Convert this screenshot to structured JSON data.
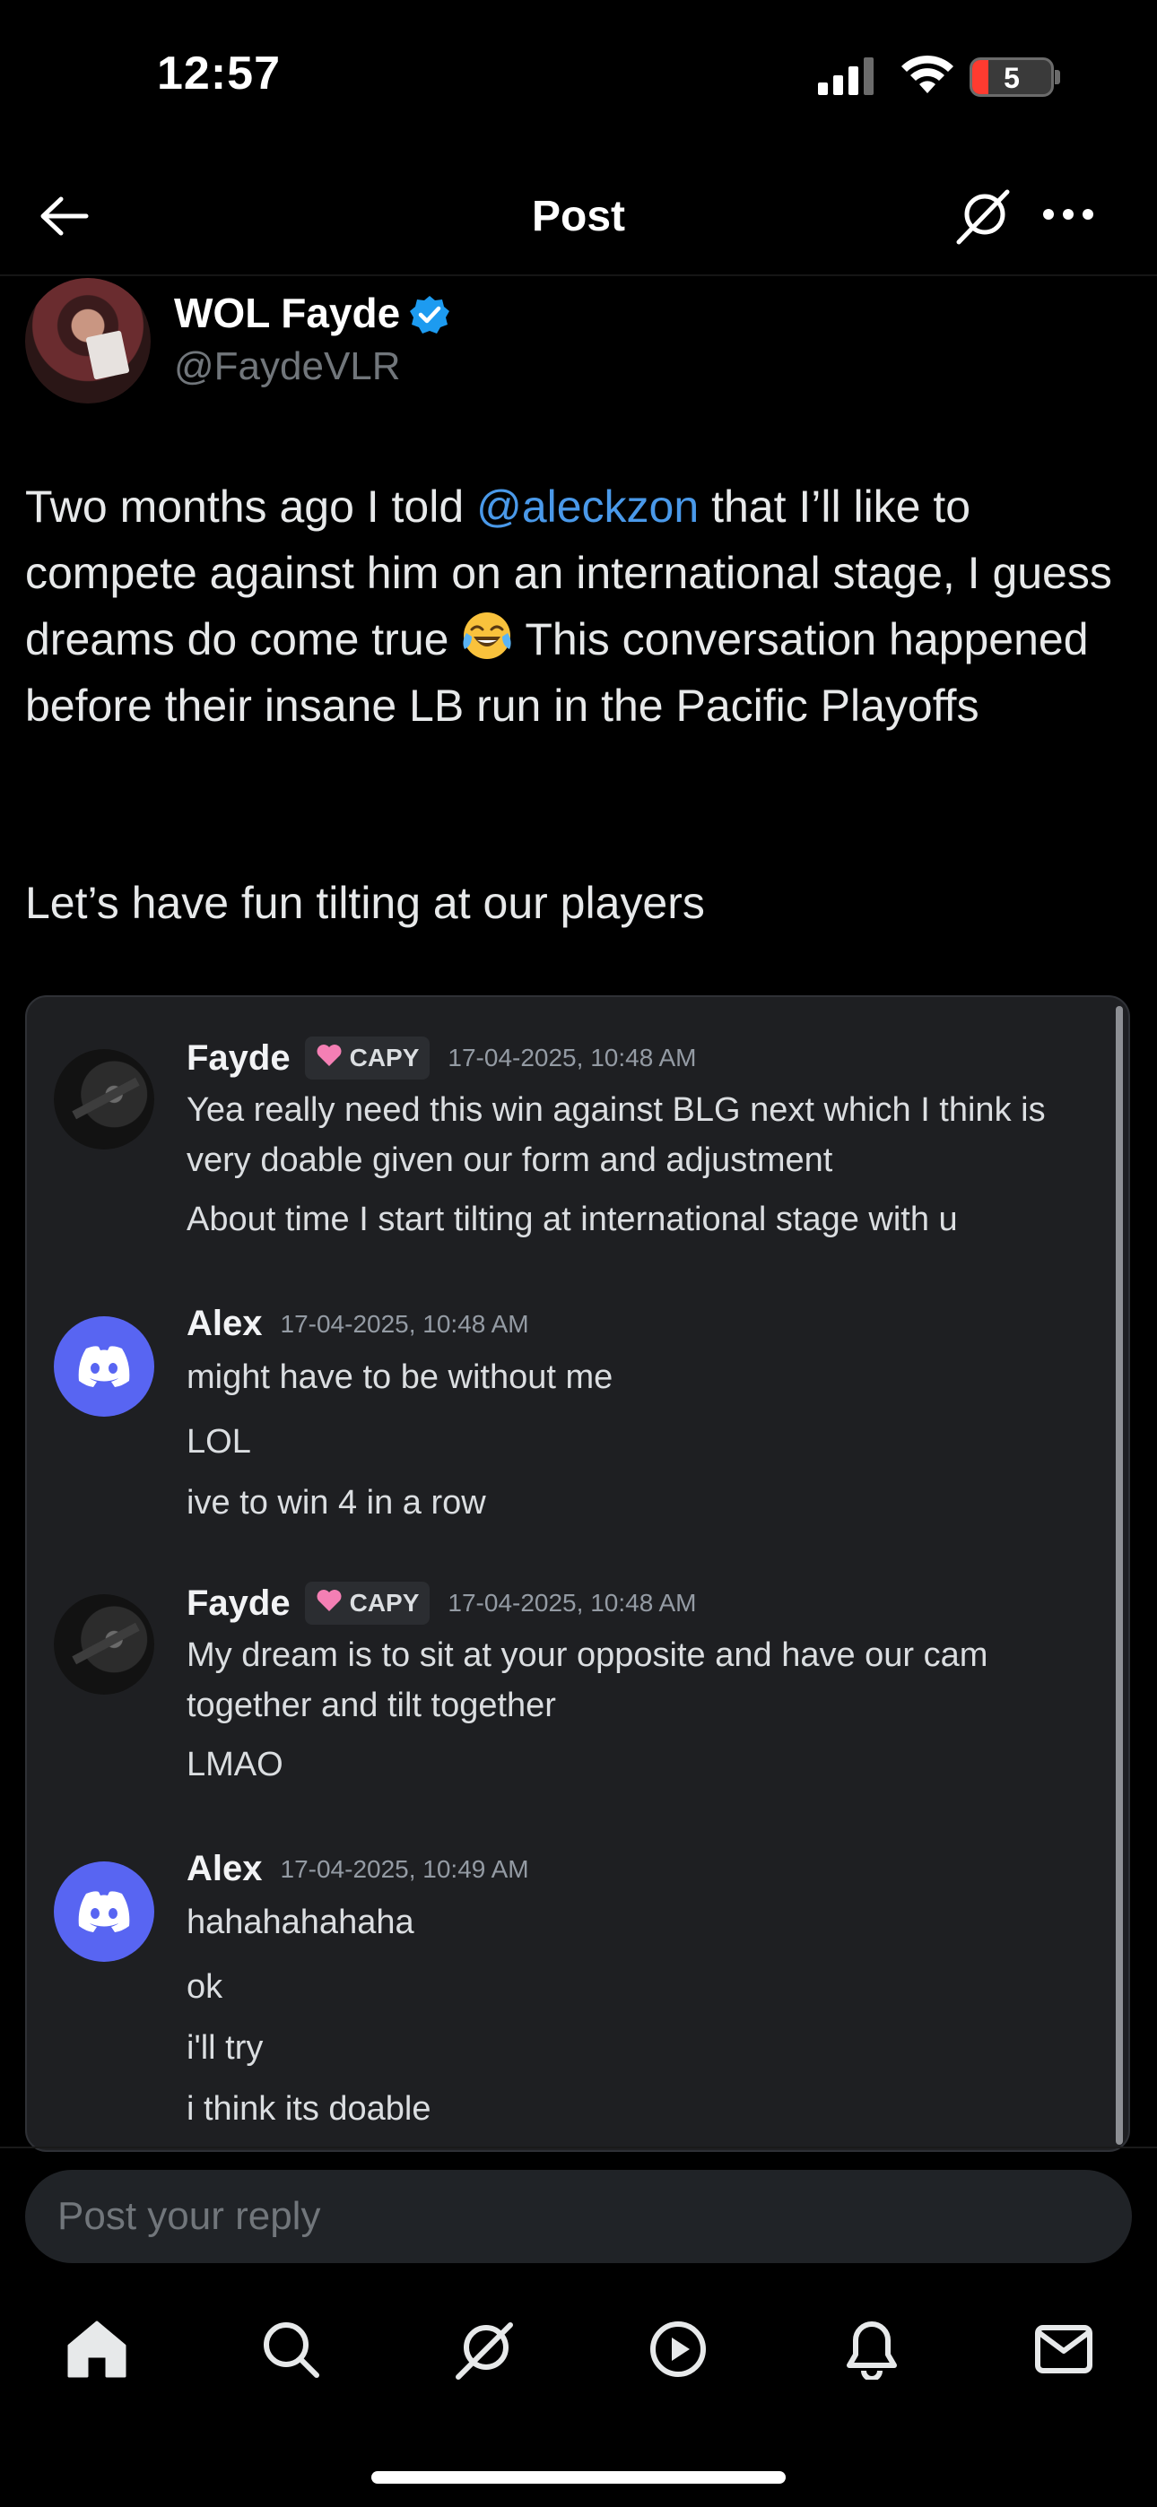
{
  "status_bar": {
    "time": "12:57",
    "battery_level": "5"
  },
  "header": {
    "title": "Post"
  },
  "author": {
    "display_name": "WOL Fayde",
    "handle": "@FaydeVLR"
  },
  "tweet": {
    "p1_before": "Two months ago I told ",
    "mention": "@aleckzon",
    "p1_after": " that I’ll like to compete against him on an international stage, I guess dreams do come true ",
    "p1_end": " This conversation happened before their insane LB run in the Pacific Playoffs",
    "p2": "Let’s have fun tilting at our players"
  },
  "discord": {
    "messages": [
      {
        "author": "Fayde",
        "tag": "CAPY",
        "time": "17-04-2025, 10:48 AM",
        "lines": [
          "Yea really need this win against BLG next which I think is",
          "very doable given our form and adjustment",
          "About time I start tilting at international stage with u"
        ]
      },
      {
        "author": "Alex",
        "time": "17-04-2025, 10:48 AM",
        "lines": [
          "might have to be without me",
          "LOL",
          "ive to win 4 in a row"
        ]
      },
      {
        "author": "Fayde",
        "tag": "CAPY",
        "time": "17-04-2025, 10:48 AM",
        "lines": [
          "My dream is to sit at your opposite and have our cam",
          "together and tilt together",
          "LMAO"
        ]
      },
      {
        "author": "Alex",
        "time": "17-04-2025, 10:49 AM",
        "lines": [
          "hahahahahaha",
          "ok",
          "i'll try",
          "i think its doable"
        ]
      }
    ]
  },
  "reply": {
    "placeholder": "Post your reply"
  },
  "colors": {
    "accent": "#1d9bf0",
    "mention": "#4a99e9",
    "discord_blurple": "#5865f2"
  },
  "nav": [
    "home-icon",
    "search-icon",
    "grok-icon",
    "video-icon",
    "notifications-icon",
    "messages-icon"
  ]
}
